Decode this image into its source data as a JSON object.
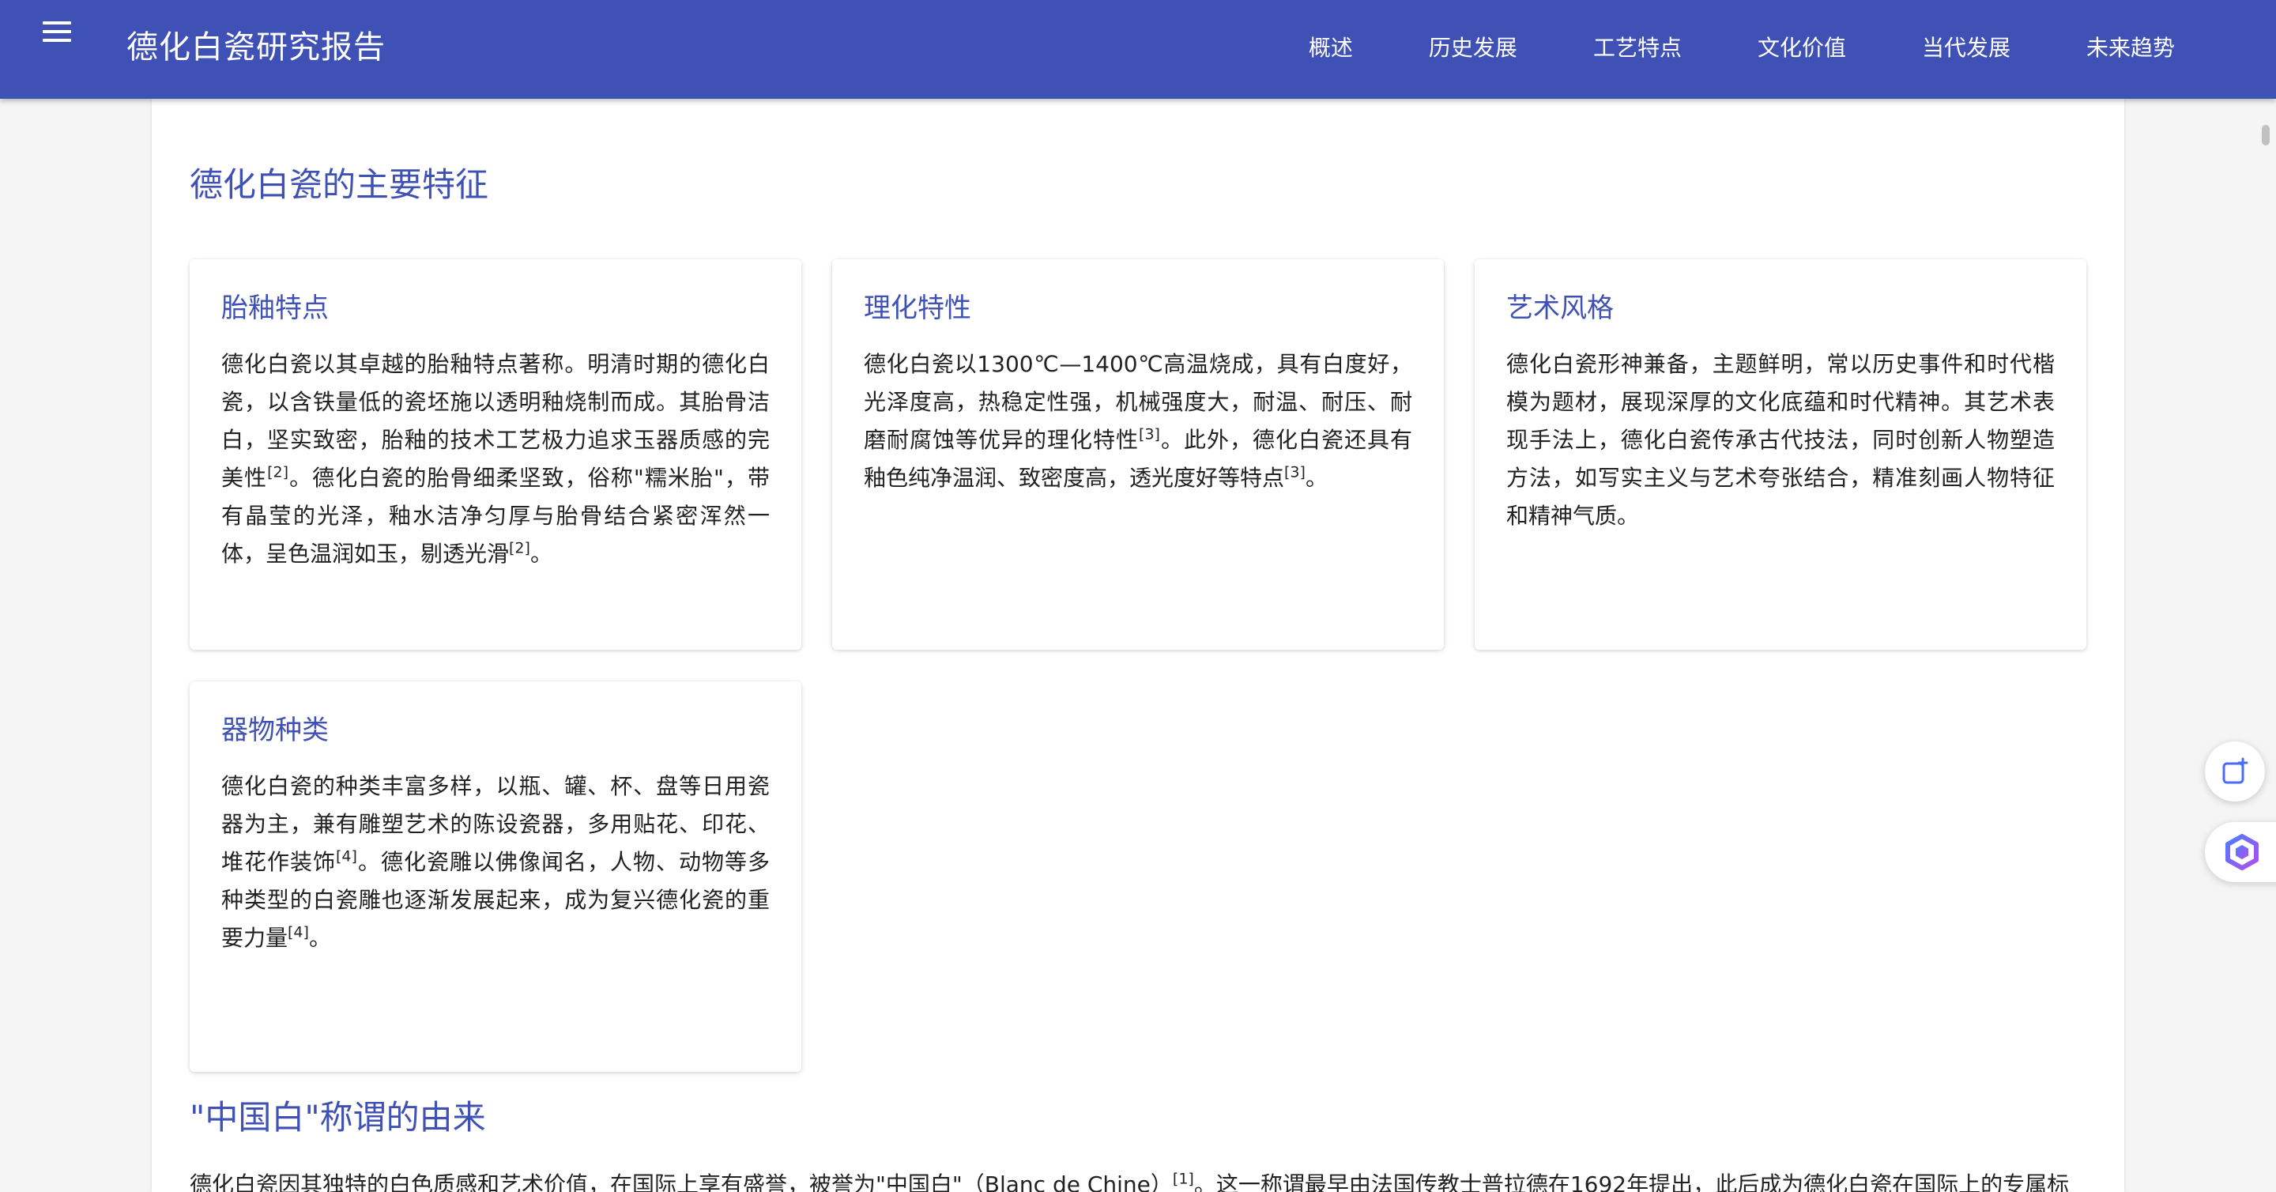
{
  "app_title": "德化白瓷研究报告",
  "nav": [
    "概述",
    "历史发展",
    "工艺特点",
    "文化价值",
    "当代发展",
    "未来趋势"
  ],
  "section1_title": "德化白瓷的主要特征",
  "cards": [
    {
      "title": "胎釉特点",
      "parts": [
        "德化白瓷以其卓越的胎釉特点著称。明清时期的德化白瓷，以含铁量低的瓷坯施以透明釉烧制而成。其胎骨洁白，坚实致密，胎釉的技术工艺极力追求玉器质感的完美性",
        "[2]",
        "。德化白瓷的胎骨细柔坚致，俗称\"糯米胎\"，带有晶莹的光泽，釉水洁净匀厚与胎骨结合紧密浑然一体，呈色温润如玉，剔透光滑",
        "[2]",
        "。"
      ]
    },
    {
      "title": "理化特性",
      "parts": [
        "德化白瓷以1300℃—1400℃高温烧成，具有白度好，光泽度高，热稳定性强，机械强度大，耐温、耐压、耐磨耐腐蚀等优异的理化特性",
        "[3]",
        "。此外，德化白瓷还具有釉色纯净温润、致密度高，透光度好等特点",
        "[3]",
        "。"
      ]
    },
    {
      "title": "艺术风格",
      "parts": [
        "德化白瓷形神兼备，主题鲜明，常以历史事件和时代楷模为题材，展现深厚的文化底蕴和时代精神。其艺术表现手法上，德化白瓷传承古代技法，同时创新人物塑造方法，如写实主义与艺术夸张结合，精准刻画人物特征和精神气质。"
      ]
    },
    {
      "title": "器物种类",
      "parts": [
        "德化白瓷的种类丰富多样，以瓶、罐、杯、盘等日用瓷器为主，兼有雕塑艺术的陈设瓷器，多用贴花、印花、堆花作装饰",
        "[4]",
        "。德化瓷雕以佛像闻名，人物、动物等多种类型的白瓷雕也逐渐发展起来，成为复兴德化瓷的重要力量",
        "[4]",
        "。"
      ]
    }
  ],
  "section2_title": "\"中国白\"称谓的由来",
  "section2_parts": [
    "德化白瓷因其独特的白色质感和艺术价值，在国际上享有盛誉，被誉为\"中国白\"（Blanc de Chine）",
    "[1]",
    "。这一称谓最早由法国传教士普拉德在1692年提出，此后成为德化白瓷在国际上的专属标"
  ],
  "colors": {
    "primary": "#3f51b5",
    "background": "#f5f5f5",
    "surface": "#ffffff"
  },
  "icons": [
    "menu-icon",
    "new-chat-icon",
    "assistant-logo-icon"
  ]
}
